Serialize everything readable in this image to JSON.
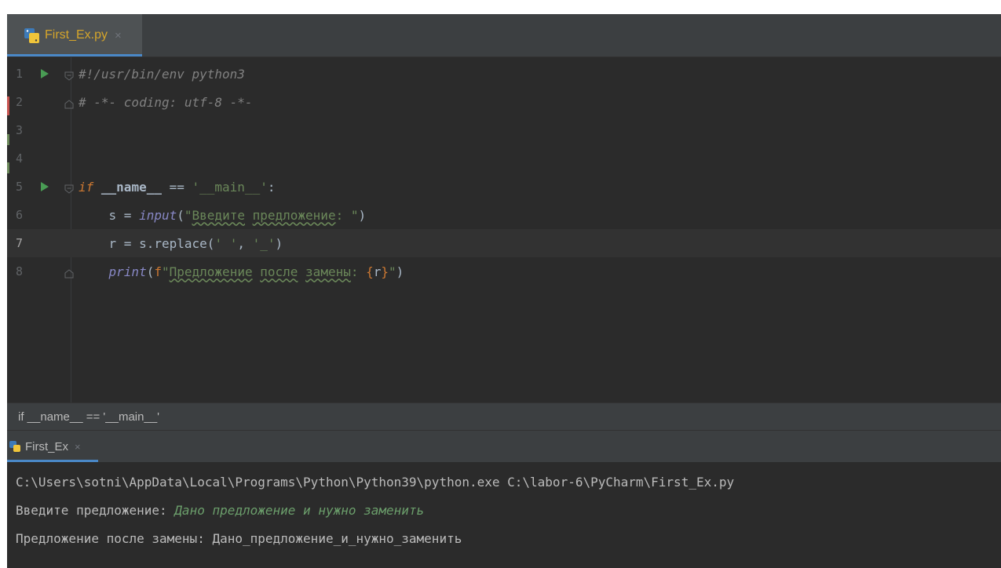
{
  "editor_tab": {
    "label": "First_Ex.py",
    "close": "×"
  },
  "editor": {
    "current_line": 7,
    "lines": [
      {
        "num": "1",
        "text": "#!/usr/bin/env python3"
      },
      {
        "num": "2",
        "text": "# -*- coding: utf-8 -*-"
      },
      {
        "num": "3",
        "text": ""
      },
      {
        "num": "4",
        "text": ""
      },
      {
        "num": "5",
        "text": "if __name__ == '__main__':"
      },
      {
        "num": "6",
        "text": "    s = input(\"Введите предложение: \")"
      },
      {
        "num": "7",
        "text": "    r = s.replace(' ', '_')"
      },
      {
        "num": "8",
        "text": "    print(f\"Предложение после замены: {r}\")"
      }
    ]
  },
  "breadcrumb": "if __name__ == '__main__'",
  "run_tab": {
    "label": "First_Ex",
    "close": "×"
  },
  "console": {
    "command": "C:\\Users\\sotni\\AppData\\Local\\Programs\\Python\\Python39\\python.exe C:\\labor-6\\PyCharm\\First_Ex.py",
    "prompt": "Введите предложение: ",
    "user_input": "Дано предложение и нужно заменить",
    "result": "Предложение после замены: Дано_предложение_и_нужно_заменить"
  },
  "colors": {
    "editor_bg": "#2b2b2b",
    "panel_bg": "#3c3f41",
    "accent": "#4a88c7",
    "run_green": "#499c54",
    "keyword": "#cc7832",
    "string": "#6a8759",
    "comment": "#808080",
    "builtin": "#8888c6",
    "dunder": "#b200b2"
  }
}
